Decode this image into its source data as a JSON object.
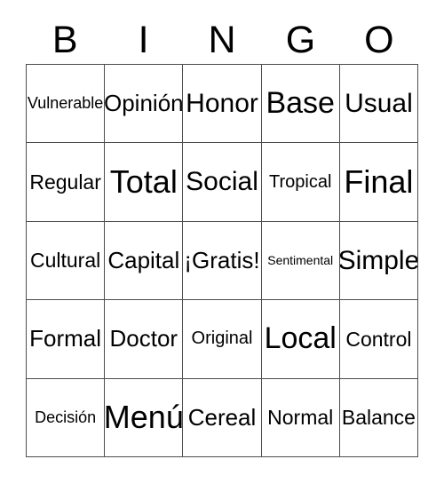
{
  "card": {
    "title": "BINGO",
    "header_letters": [
      "B",
      "I",
      "N",
      "G",
      "O"
    ],
    "free_space_text": "¡Gratis!",
    "colors": {
      "background": "#ffffff",
      "grid_line": "#4d4d4d",
      "text": "#000000"
    },
    "grid": {
      "columns": 5,
      "rows": 5,
      "cells": [
        [
          {
            "text": "Vulnerable",
            "size": "s-sm"
          },
          {
            "text": "Opinión",
            "size": "s-xl"
          },
          {
            "text": "Honor",
            "size": "s-xxl"
          },
          {
            "text": "Base",
            "size": "s-huge"
          },
          {
            "text": "Usual",
            "size": "s-xxl"
          }
        ],
        [
          {
            "text": "Regular",
            "size": "s-lg"
          },
          {
            "text": "Total",
            "size": "s-max"
          },
          {
            "text": "Social",
            "size": "s-xxl"
          },
          {
            "text": "Tropical",
            "size": "s-md"
          },
          {
            "text": "Final",
            "size": "s-max"
          }
        ],
        [
          {
            "text": "Cultural",
            "size": "s-lg"
          },
          {
            "text": "Capital",
            "size": "s-xl"
          },
          {
            "text": "¡Gratis!",
            "size": "s-xl"
          },
          {
            "text": "Sentimental",
            "size": "s-xs"
          },
          {
            "text": "Simple",
            "size": "s-xxl"
          }
        ],
        [
          {
            "text": "Formal",
            "size": "s-xl"
          },
          {
            "text": "Doctor",
            "size": "s-xl"
          },
          {
            "text": "Original",
            "size": "s-md"
          },
          {
            "text": "Local",
            "size": "s-huge"
          },
          {
            "text": "Control",
            "size": "s-lg"
          }
        ],
        [
          {
            "text": "Decisión",
            "size": "s-sm"
          },
          {
            "text": "Menú",
            "size": "s-max"
          },
          {
            "text": "Cereal",
            "size": "s-xl"
          },
          {
            "text": "Normal",
            "size": "s-lg"
          },
          {
            "text": "Balance",
            "size": "s-lg"
          }
        ]
      ]
    }
  }
}
